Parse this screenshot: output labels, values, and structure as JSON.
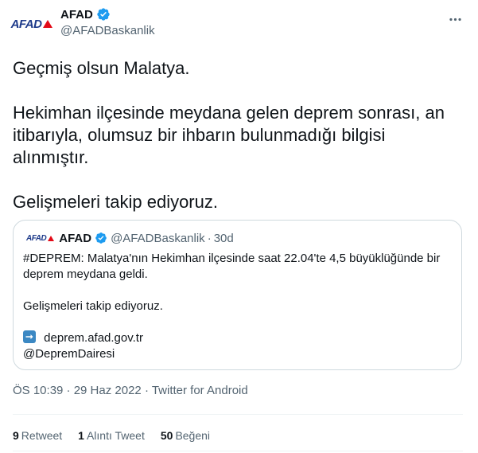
{
  "author": {
    "avatar_text": "AFAD",
    "display_name": "AFAD",
    "handle": "@AFADBaskanlik"
  },
  "menu": {
    "more_label": "···"
  },
  "tweet": {
    "lines": [
      "Geçmiş olsun Malatya.",
      "",
      "Hekimhan ilçesinde meydana gelen deprem sonrası, an",
      "itibarıyla, olumsuz bir ihbarın bulunmadığı bilgisi",
      "alınmıştır.",
      "",
      "Gelişmeleri takip ediyoruz."
    ]
  },
  "quote": {
    "avatar_text": "AFAD",
    "display_name": "AFAD",
    "handle": "@AFADBaskanlik",
    "separator": "·",
    "time": "30d",
    "lines": [
      "#DEPREM: Malatya'nın Hekimhan ilçesinde saat 22.04'te 4,5 büyüklüğünde bir",
      "deprem meydana geldi."
    ],
    "follow_up": "Gelişmeleri takip ediyoruz.",
    "link": "deprem.afad.gov.tr",
    "mention": "@DepremDairesi"
  },
  "meta": {
    "text": "ÖS 10:39 · 29 Haz 2022 · Twitter for Android"
  },
  "stats": {
    "retweets_count": "9",
    "retweets_label": "Retweet",
    "quotes_count": "1",
    "quotes_label": "Alıntı Tweet",
    "likes_count": "50",
    "likes_label": "Beğeni"
  },
  "colors": {
    "verified": "#1d9bf0",
    "afad_blue": "#1d3a8a",
    "afad_red": "#e30a17",
    "secondary_text": "#536471",
    "border": "#cfd9de"
  },
  "icons": {
    "verified": "verified-badge-icon",
    "more": "more-horizontal-icon",
    "link": "right-arrow-icon"
  }
}
